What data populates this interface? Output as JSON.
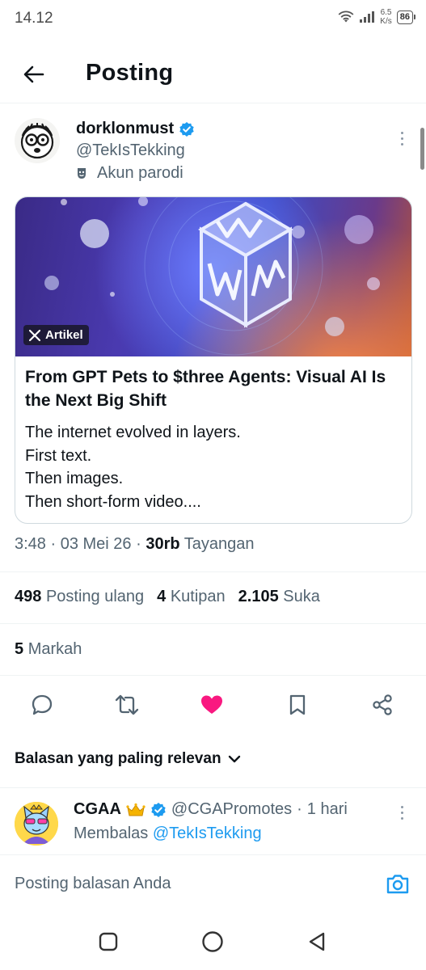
{
  "status_bar": {
    "time": "14.12",
    "net_speed_top": "6.5",
    "net_speed_bottom": "K/s",
    "battery": "86"
  },
  "header": {
    "title": "Posting"
  },
  "post": {
    "display_name": "dorklonmust",
    "handle": "@TekIsTekking",
    "parody_label": "Akun parodi",
    "article": {
      "badge_label": "Artikel",
      "title": "From GPT Pets to $three Agents: Visual AI Is the Next Big Shift",
      "body_lines": [
        "The internet evolved in layers.",
        "First text.",
        "Then images.",
        "Then short-form video...."
      ]
    },
    "meta": {
      "time": "3:48",
      "sep": " · ",
      "date": "03 Mei 26",
      "views": "30rb",
      "views_label": "Tayangan"
    },
    "stats": {
      "reposts": "498",
      "reposts_label": "Posting ulang",
      "quotes": "4",
      "quotes_label": "Kutipan",
      "likes": "2.105",
      "likes_label": "Suka"
    },
    "bookmarks": {
      "count": "5",
      "label": "Markah"
    }
  },
  "colors": {
    "accent": "#1d9bf0",
    "like": "#f91880",
    "text": "#0f1419",
    "muted": "#536471"
  },
  "icons": {
    "actions": [
      "reply-icon",
      "repost-icon",
      "heart-icon",
      "bookmark-icon",
      "share-icon"
    ],
    "nav": [
      "recents-icon",
      "home-icon",
      "back-icon"
    ]
  },
  "replies": {
    "sort_label": "Balasan yang paling relevan",
    "items": [
      {
        "name": "CGAA",
        "handle": "@CGAPromotes",
        "time": "1 hari",
        "replying_prefix": "Membalas",
        "replying_to": "@TekIsTekking"
      }
    ]
  },
  "compose": {
    "placeholder": "Posting balasan Anda"
  }
}
